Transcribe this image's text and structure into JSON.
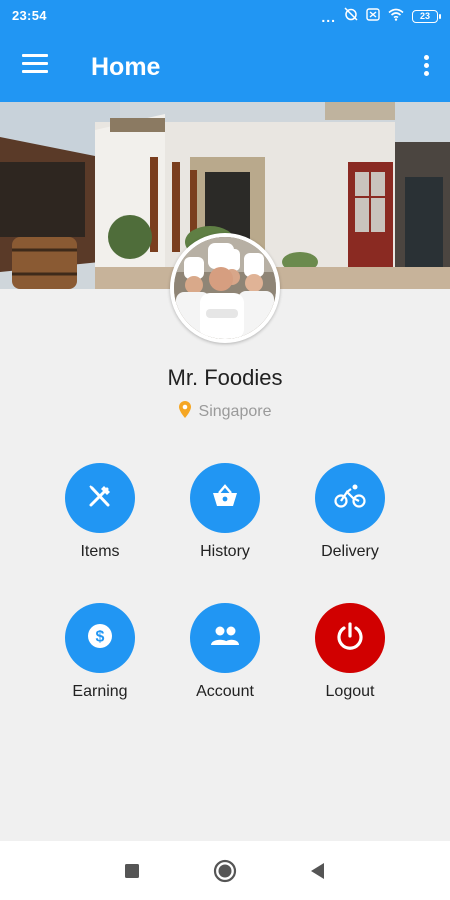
{
  "status_bar": {
    "time": "23:54",
    "battery": "23",
    "overflow": "..."
  },
  "app_bar": {
    "title": "Home"
  },
  "profile": {
    "name": "Mr. Foodies",
    "location": "Singapore"
  },
  "actions": [
    {
      "label": "Items",
      "icon": "fork-knife-icon",
      "color": "#2196f3"
    },
    {
      "label": "History",
      "icon": "basket-icon",
      "color": "#2196f3"
    },
    {
      "label": "Delivery",
      "icon": "bicycle-icon",
      "color": "#2196f3"
    },
    {
      "label": "Earning",
      "icon": "dollar-icon",
      "color": "#2196f3"
    },
    {
      "label": "Account",
      "icon": "people-icon",
      "color": "#2196f3"
    },
    {
      "label": "Logout",
      "icon": "power-icon",
      "color": "#d10000"
    }
  ],
  "colors": {
    "primary": "#2196f3",
    "logout": "#d10000",
    "location_pin": "#f5a623"
  }
}
